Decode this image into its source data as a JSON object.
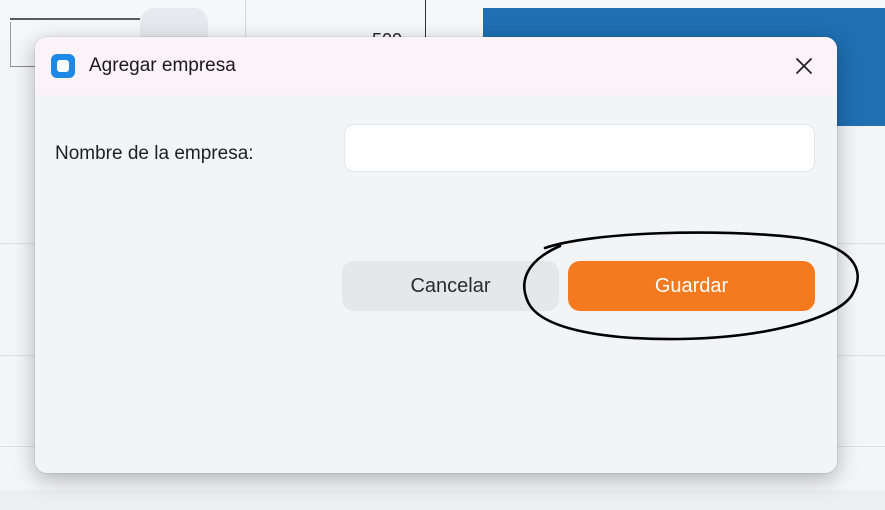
{
  "background": {
    "partial_number": "500"
  },
  "dialog": {
    "title": "Agregar empresa",
    "app_icon": "app-square-icon",
    "close_icon": "close-icon",
    "field_label": "Nombre de la empresa:",
    "field_value": "",
    "field_placeholder": "",
    "cancel_label": "Cancelar",
    "save_label": "Guardar"
  },
  "colors": {
    "titlebar_bg": "#fbf2fa",
    "accent_orange": "#f57a1f",
    "cancel_bg": "#e5e7eb",
    "app_icon_blue": "#1e88e5",
    "background_header_blue": "#1f6fb2"
  }
}
